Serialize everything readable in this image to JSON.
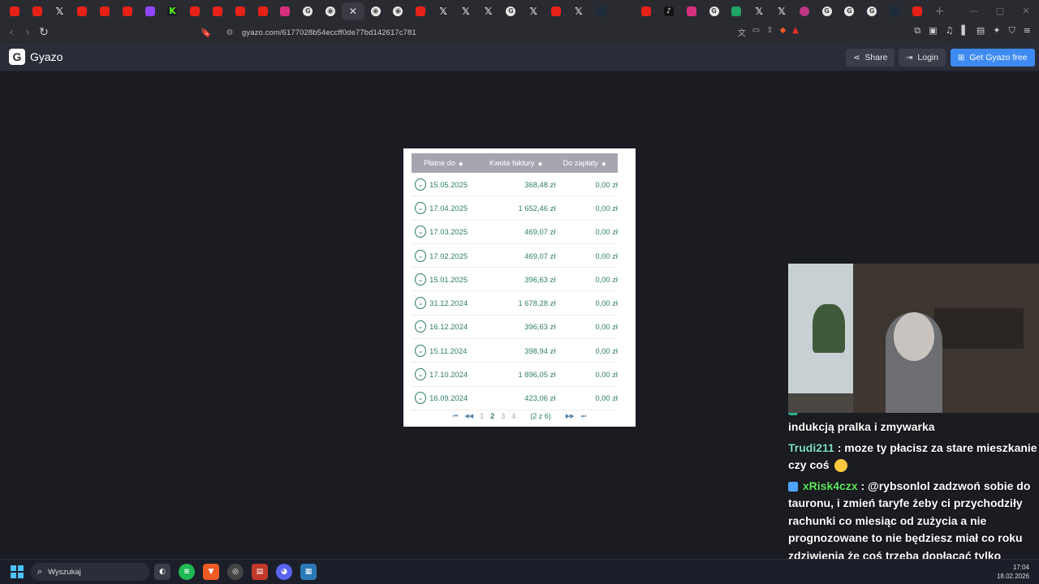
{
  "browser": {
    "tabs": [
      {
        "kind": "yt",
        "glyph": ""
      },
      {
        "kind": "yt",
        "glyph": ""
      },
      {
        "kind": "x",
        "glyph": "𝕏"
      },
      {
        "kind": "yt",
        "glyph": ""
      },
      {
        "kind": "yt",
        "glyph": ""
      },
      {
        "kind": "yt",
        "glyph": ""
      },
      {
        "kind": "tw",
        "glyph": ""
      },
      {
        "kind": "kick",
        "glyph": "K"
      },
      {
        "kind": "yt",
        "glyph": ""
      },
      {
        "kind": "yt",
        "glyph": ""
      },
      {
        "kind": "yt",
        "glyph": ""
      },
      {
        "kind": "yt",
        "glyph": ""
      },
      {
        "kind": "ig",
        "glyph": ""
      },
      {
        "kind": "g",
        "glyph": "G"
      },
      {
        "kind": "gl",
        "glyph": "◉"
      },
      {
        "kind": "close",
        "glyph": "✕"
      },
      {
        "kind": "gl",
        "glyph": "◉"
      },
      {
        "kind": "gl",
        "glyph": "◉"
      },
      {
        "kind": "yt",
        "glyph": ""
      },
      {
        "kind": "x",
        "glyph": "𝕏"
      },
      {
        "kind": "x",
        "glyph": "𝕏"
      },
      {
        "kind": "x",
        "glyph": "𝕏"
      },
      {
        "kind": "g",
        "glyph": "G"
      },
      {
        "kind": "x",
        "glyph": "𝕏"
      },
      {
        "kind": "yt",
        "glyph": ""
      },
      {
        "kind": "x",
        "glyph": "𝕏"
      },
      {
        "kind": "gh",
        "glyph": ""
      },
      {
        "kind": "chat",
        "glyph": ""
      },
      {
        "kind": "yt",
        "glyph": ""
      },
      {
        "kind": "tt",
        "glyph": "♪"
      },
      {
        "kind": "ig",
        "glyph": ""
      },
      {
        "kind": "g",
        "glyph": "G"
      },
      {
        "kind": "sheet",
        "glyph": ""
      },
      {
        "kind": "x",
        "glyph": "𝕏"
      },
      {
        "kind": "x",
        "glyph": "𝕏"
      },
      {
        "kind": "pur",
        "glyph": ""
      },
      {
        "kind": "g",
        "glyph": "G"
      },
      {
        "kind": "g",
        "glyph": "G"
      },
      {
        "kind": "g",
        "glyph": "G"
      },
      {
        "kind": "gh",
        "glyph": ""
      },
      {
        "kind": "yt",
        "glyph": ""
      }
    ],
    "url": "gyazo.com/6177028b54eccff0de77bd142617c781"
  },
  "gyazo": {
    "logo_text": "Gyazo",
    "share_label": "Share",
    "login_label": "Login",
    "get_label": "Get Gyazo free"
  },
  "invoices": {
    "headers": {
      "due_date": "Płatne do",
      "amount": "Kwota faktury",
      "to_pay": "Do zapłaty"
    },
    "rows": [
      {
        "date": "15.05.2025",
        "amount": "368,48 zł",
        "to_pay": "0,00 zł"
      },
      {
        "date": "17.04.2025",
        "amount": "1 652,46 zł",
        "to_pay": "0,00 zł"
      },
      {
        "date": "17.03.2025",
        "amount": "469,07 zł",
        "to_pay": "0,00 zł"
      },
      {
        "date": "17.02.2025",
        "amount": "469,07 zł",
        "to_pay": "0,00 zł"
      },
      {
        "date": "15.01.2025",
        "amount": "396,63 zł",
        "to_pay": "0,00 zł"
      },
      {
        "date": "31.12.2024",
        "amount": "1 678,28 zł",
        "to_pay": "0,00 zł"
      },
      {
        "date": "16.12.2024",
        "amount": "396,63 zł",
        "to_pay": "0,00 zł"
      },
      {
        "date": "15.11.2024",
        "amount": "398,94 zł",
        "to_pay": "0,00 zł"
      },
      {
        "date": "17.10.2024",
        "amount": "1 896,05 zł",
        "to_pay": "0,00 zł"
      },
      {
        "date": "16.09.2024",
        "amount": "423,06 zł",
        "to_pay": "0,00 zł"
      }
    ],
    "pager": {
      "pages": [
        "1",
        "2",
        "3",
        "4"
      ],
      "current": "2",
      "summary": "(2 z 6)"
    }
  },
  "chat": {
    "line0": "indukcją pralka i zmywarka",
    "msg1_user": "Trudi211",
    "msg1_text": ": moze ty płacisz za stare mieszkanie czy coś",
    "msg2_user": "xRisk4czx",
    "msg2_text": ": @rybsonlol zadzwoń sobie do tauronu, i zmień taryfe żeby ci przychodziły rachunki co miesiąc od zużycia a nie prognozowane to nie będziesz miał co roku zdziwienia że coś trzeba dopłacać tylko będziesz płacił tylko za to co zużyjesz"
  },
  "taskbar": {
    "search_placeholder": "Wyszukaj",
    "time": "17:04",
    "date": "18.02.2026"
  }
}
